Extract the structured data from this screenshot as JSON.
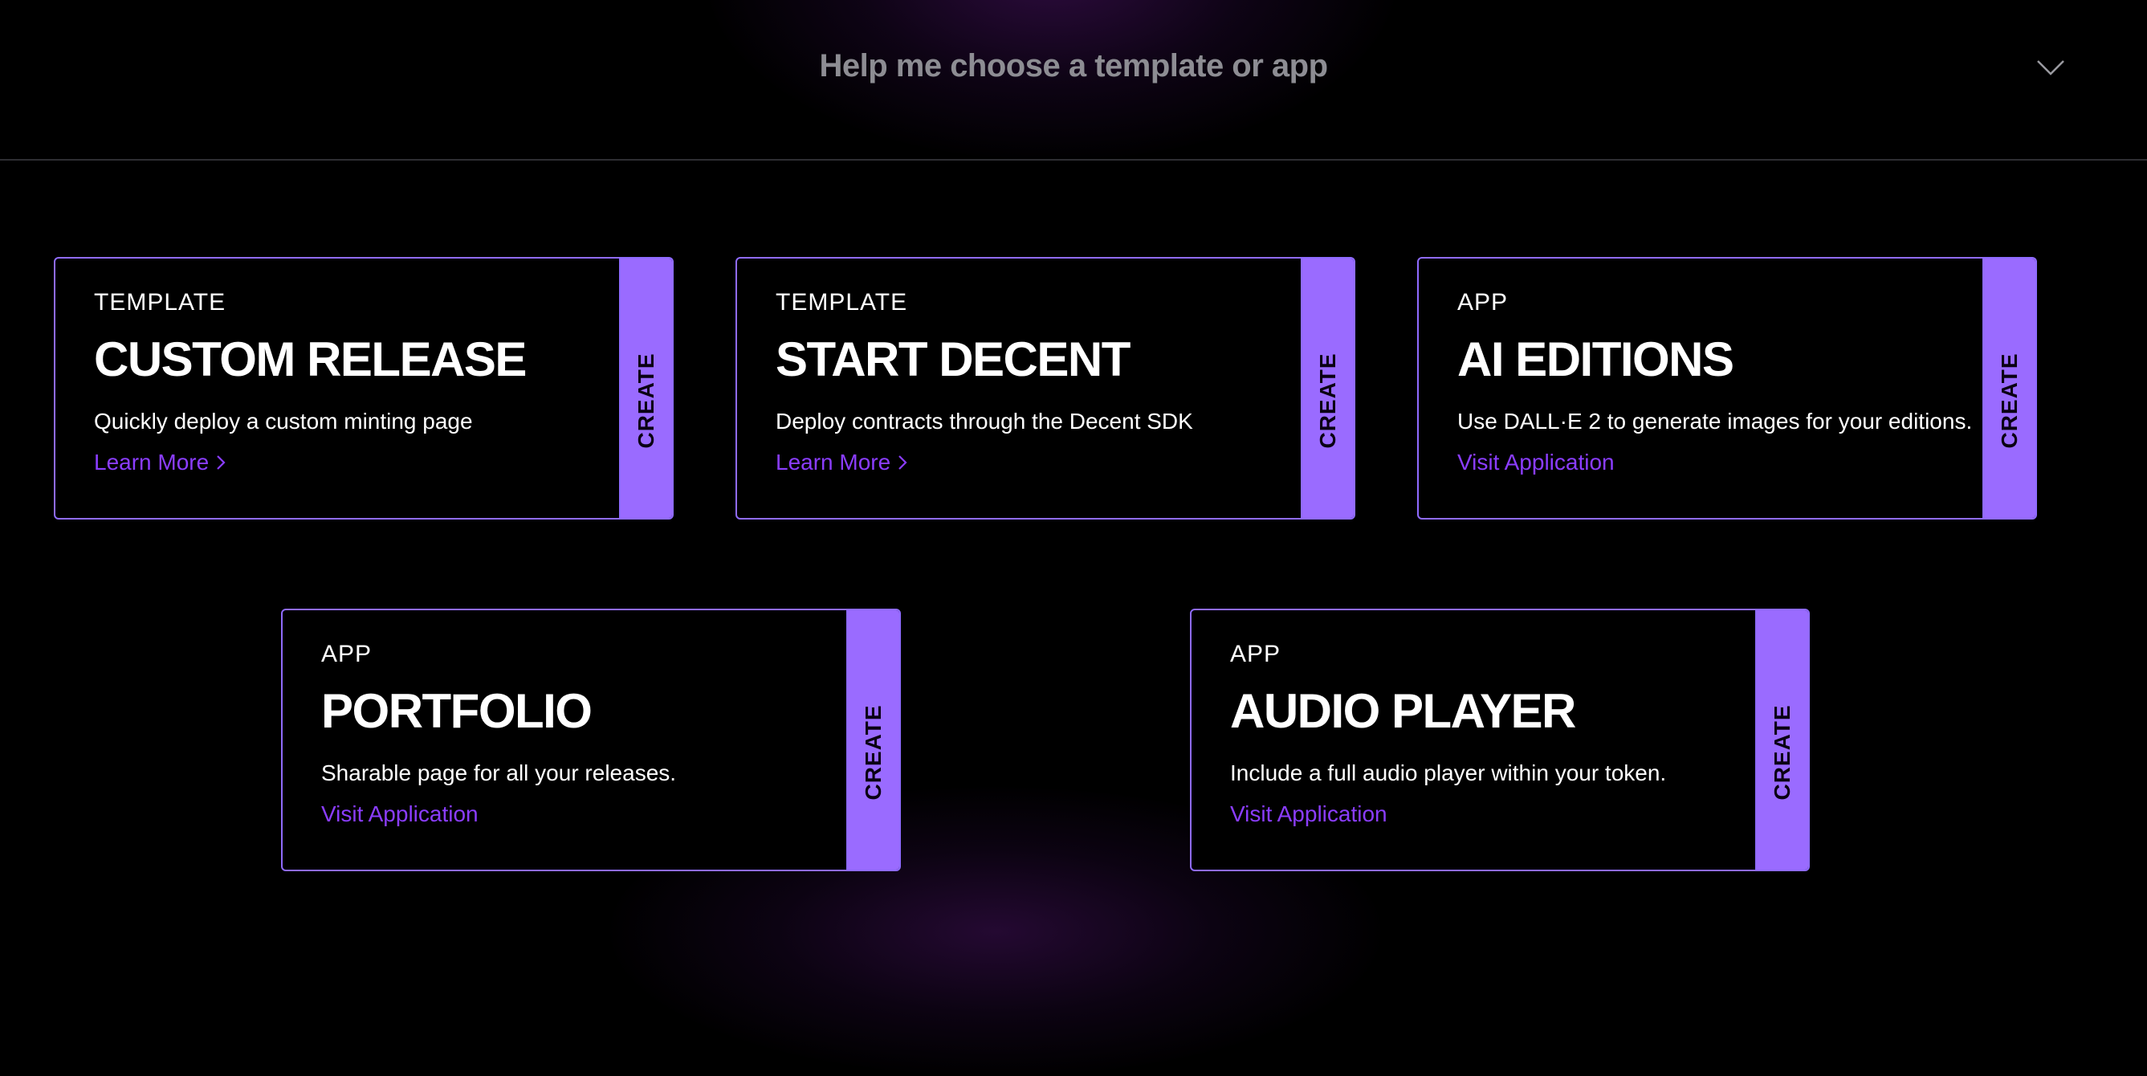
{
  "header": {
    "title": "Help me choose a template or app",
    "chevron_icon": "chevron-down-icon"
  },
  "colors": {
    "accent": "#9a6bff",
    "border": "#8f6bff",
    "link": "#8b3dff",
    "background": "#000000"
  },
  "cards": [
    {
      "type": "TEMPLATE",
      "title": "CUSTOM RELEASE",
      "description": "Quickly deploy a custom minting page",
      "link_label": "Learn More",
      "link_icon": "chevron-right-icon",
      "create_label": "CREATE"
    },
    {
      "type": "TEMPLATE",
      "title": "START DECENT",
      "description": "Deploy contracts through the Decent SDK",
      "link_label": "Learn More",
      "link_icon": "chevron-right-icon",
      "create_label": "CREATE"
    },
    {
      "type": "APP",
      "title": "AI EDITIONS",
      "description": "Use DALL·E 2 to generate images for your editions.",
      "link_label": "Visit Application",
      "create_label": "CREATE"
    },
    {
      "type": "APP",
      "title": "PORTFOLIO",
      "description": "Sharable page for all your releases.",
      "link_label": "Visit Application",
      "create_label": "CREATE"
    },
    {
      "type": "APP",
      "title": "AUDIO PLAYER",
      "description": "Include a full audio player within your token.",
      "link_label": "Visit Application",
      "create_label": "CREATE"
    }
  ]
}
